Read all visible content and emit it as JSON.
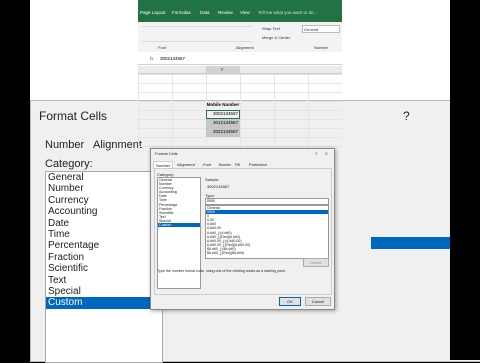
{
  "bg_dialog": {
    "title": "Format Cells",
    "help": "?",
    "tabs": [
      "Number",
      "Alignment"
    ],
    "category_label": "Category:",
    "categories": [
      "General",
      "Number",
      "Currency",
      "Accounting",
      "Date",
      "Time",
      "Percentage",
      "Fraction",
      "Scientific",
      "Text",
      "Special",
      "Custom"
    ],
    "selected_index": 11
  },
  "excel": {
    "tabs": [
      "Page Layout",
      "Formulas",
      "Data",
      "Review",
      "View"
    ],
    "tell_me": "Tell me what you want to do...",
    "ribbon": {
      "wrap_text": "Wrap Text",
      "merge_center": "Merge & Center",
      "number_format": "General",
      "font_group": "Font",
      "alignment_group": "Alignment",
      "number_group": "Number"
    },
    "formula_value": "3002134567",
    "column_letter": "F",
    "header_cell": "Mobile Number",
    "values": [
      "3002134567",
      "3012134567",
      "3022134567"
    ]
  },
  "dialog": {
    "title": "Format Cells",
    "help": "?",
    "close": "X",
    "tabs": [
      "Number",
      "Alignment",
      "Font",
      "Border",
      "Fill",
      "Protection"
    ],
    "category_label": "Category:",
    "categories": [
      "General",
      "Number",
      "Currency",
      "Accounting",
      "Date",
      "Time",
      "Percentage",
      "Fraction",
      "Scientific",
      "Text",
      "Special",
      "Custom"
    ],
    "selected_category": 11,
    "sample_label": "Sample",
    "sample_value": "3002134567",
    "type_label": "Type:",
    "type_value": "0000",
    "types": [
      "General",
      "0000",
      "0",
      "0.00",
      "#,##0",
      "#,##0.00",
      "#,##0_);(#,##0)",
      "#,##0_);[Red](#,##0)",
      "#,##0.00_);(#,##0.00)",
      "#,##0.00_);[Red](#,##0.00)",
      "$#,##0_);($#,##0)",
      "$#,##0_);[Red]($#,##0)"
    ],
    "selected_type": 1,
    "delete_label": "Delete",
    "hint": "Type the number format code, using one of the existing codes as a starting point.",
    "ok_label": "OK",
    "cancel_label": "Cancel"
  }
}
